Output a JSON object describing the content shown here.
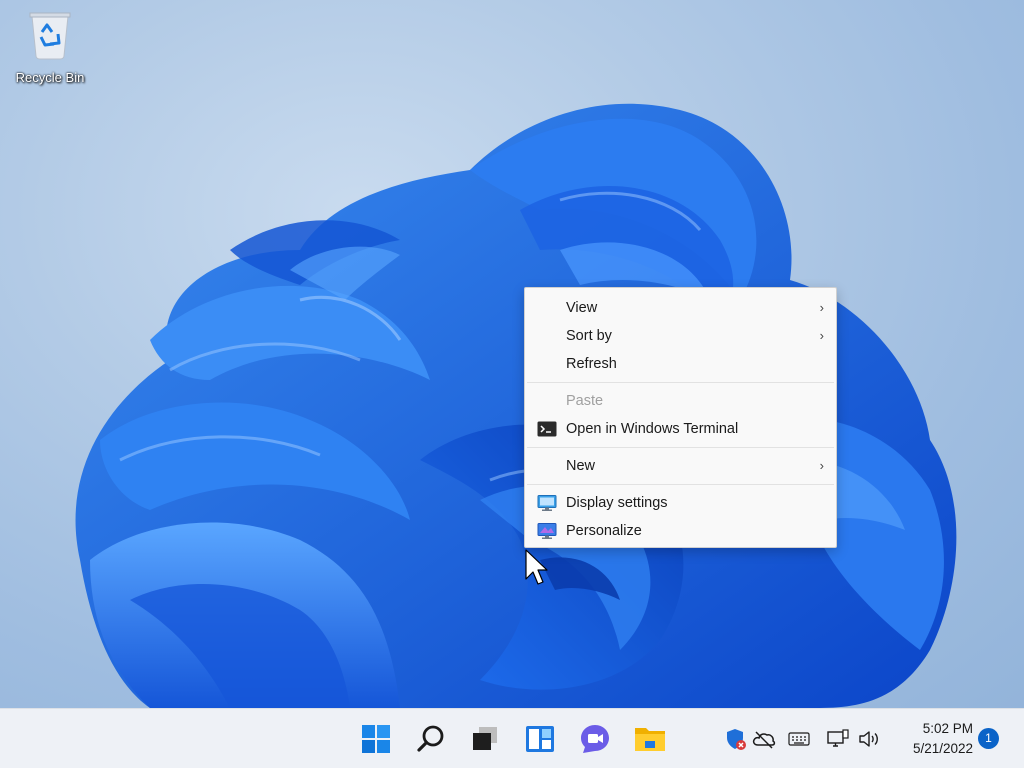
{
  "desktop": {
    "icons": [
      {
        "label": "Recycle Bin",
        "icon": "recycle-bin-icon"
      }
    ]
  },
  "context_menu": {
    "items": [
      {
        "label": "View",
        "has_submenu": true,
        "enabled": true,
        "icon": ""
      },
      {
        "label": "Sort by",
        "has_submenu": true,
        "enabled": true,
        "icon": ""
      },
      {
        "label": "Refresh",
        "has_submenu": false,
        "enabled": true,
        "icon": ""
      },
      {
        "label": "Paste",
        "has_submenu": false,
        "enabled": false,
        "icon": ""
      },
      {
        "label": "Open in Windows Terminal",
        "has_submenu": false,
        "enabled": true,
        "icon": "terminal-icon"
      },
      {
        "label": "New",
        "has_submenu": true,
        "enabled": true,
        "icon": ""
      },
      {
        "label": "Display settings",
        "has_submenu": false,
        "enabled": true,
        "icon": "display-settings-icon"
      },
      {
        "label": "Personalize",
        "has_submenu": false,
        "enabled": true,
        "icon": "personalize-icon"
      }
    ],
    "submenu_glyph": "›"
  },
  "taskbar": {
    "pinned": [
      {
        "name": "start",
        "icon": "windows-start-icon"
      },
      {
        "name": "search",
        "icon": "search-icon"
      },
      {
        "name": "task-view",
        "icon": "task-view-icon"
      },
      {
        "name": "widgets",
        "icon": "widgets-icon"
      },
      {
        "name": "chat",
        "icon": "chat-icon"
      },
      {
        "name": "file-explorer",
        "icon": "file-explorer-icon"
      }
    ],
    "tray": [
      {
        "name": "security",
        "icon": "windows-security-icon"
      },
      {
        "name": "onedrive",
        "icon": "onedrive-offline-icon"
      },
      {
        "name": "keyboard",
        "icon": "touch-keyboard-icon"
      },
      {
        "name": "network",
        "icon": "network-icon"
      },
      {
        "name": "volume",
        "icon": "volume-icon"
      }
    ],
    "clock": {
      "time": "5:02 PM",
      "date": "5/21/2022"
    },
    "notifications": {
      "count": "1"
    }
  },
  "colors": {
    "accent": "#0a63c8",
    "wallpaper_bloom": "#1a6be6",
    "taskbar_bg": "#eef1f6",
    "menu_bg": "#f9f9f9"
  }
}
